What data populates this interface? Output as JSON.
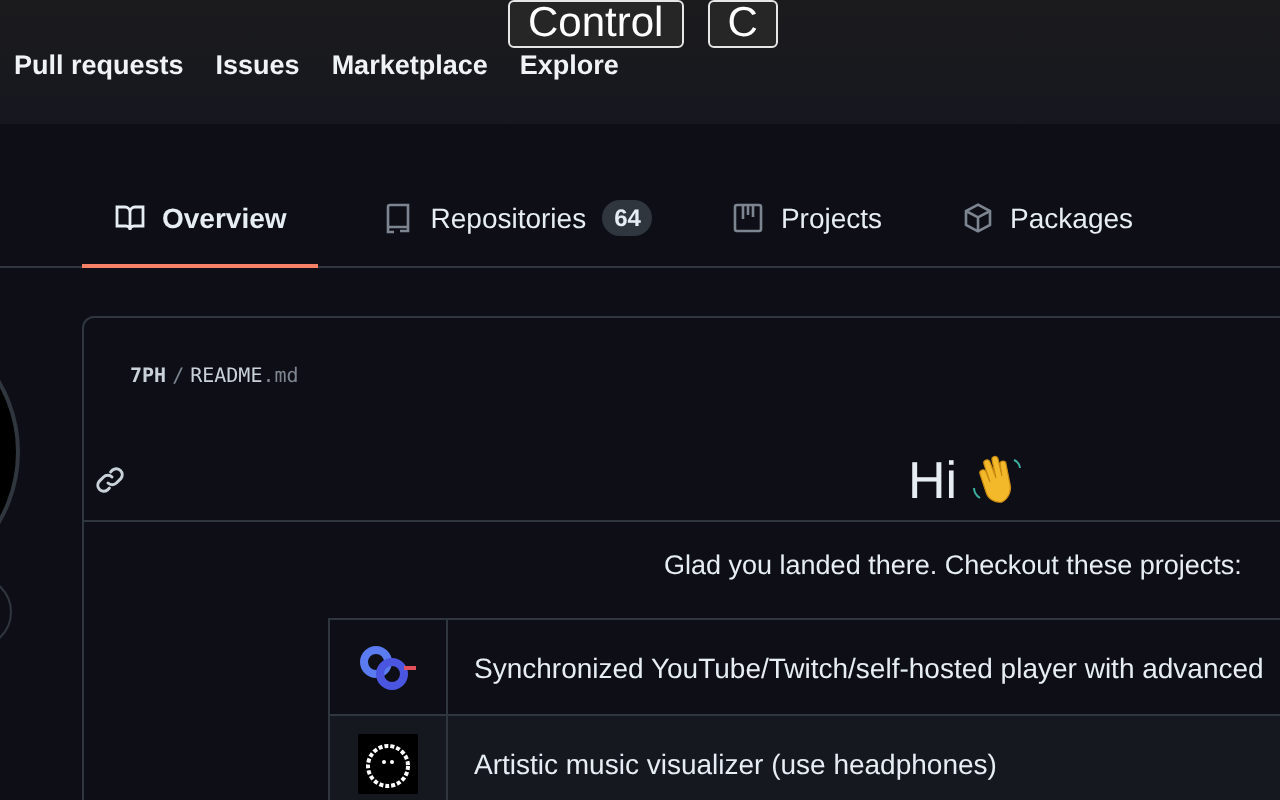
{
  "nav": [
    "Pull requests",
    "Issues",
    "Marketplace",
    "Explore"
  ],
  "key_overlay": [
    "Control",
    "C"
  ],
  "tabs": [
    {
      "label": "Overview",
      "selected": true
    },
    {
      "label": "Repositories",
      "count": "64",
      "selected": false
    },
    {
      "label": "Projects",
      "selected": false
    },
    {
      "label": "Packages",
      "selected": false
    }
  ],
  "readme": {
    "owner": "7PH",
    "separator": "/",
    "file": "README",
    "extension": ".md",
    "heading": "Hi",
    "intro": "Glad you landed there. Checkout these projects:",
    "projects": [
      {
        "description": "Synchronized YouTube/Twitch/self-hosted player with advanced"
      },
      {
        "description": "Artistic music visualizer (use headphones)"
      }
    ]
  }
}
